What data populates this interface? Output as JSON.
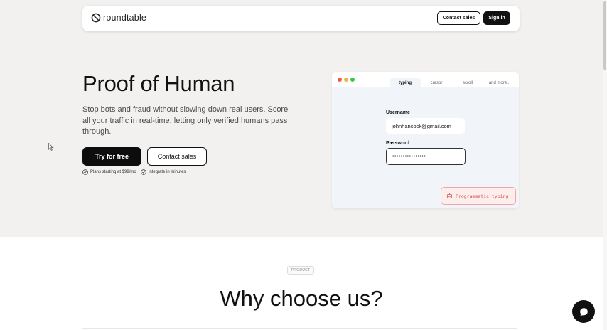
{
  "nav": {
    "logo_text": "roundtable",
    "contact_sales_label": "Contact sales",
    "sign_in_label": "Sign in"
  },
  "hero": {
    "title": "Proof of Human",
    "description": "Stop bots and fraud without slowing down real users. Score all your traffic in real-time, letting only verified humans pass through.",
    "primary_cta": "Try for free",
    "secondary_cta": "Contact sales",
    "features": [
      {
        "icon": "check-circle-icon",
        "label": "Plans starting at $99/mo"
      },
      {
        "icon": "check-circle-icon",
        "label": "Integrate in minutes"
      }
    ]
  },
  "demo": {
    "tabs": [
      {
        "label": "typing",
        "active": true
      },
      {
        "label": "cursor",
        "active": false
      },
      {
        "label": "scroll",
        "active": false
      },
      {
        "label": "and more...",
        "active": false
      }
    ],
    "username_label": "Username",
    "username_value": "johnhancock@gmail.com",
    "password_label": "Password",
    "password_value": "••••••••••••••••",
    "alert_label": "Programmatic typing",
    "colors": {
      "alert": "#d9534f",
      "dot_red": "#ee5a52",
      "dot_yellow": "#f5b532",
      "dot_green": "#3fc351"
    }
  },
  "section": {
    "badge": "PRODUCT",
    "title": "Why choose us?"
  },
  "chat": {
    "icon": "chat-bubble-icon"
  }
}
